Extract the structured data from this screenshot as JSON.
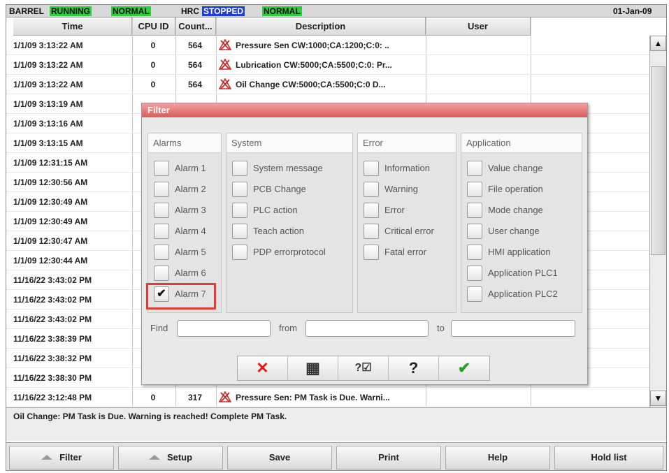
{
  "status": {
    "barrel_label": "BARREL",
    "barrel_state": "RUNNING",
    "barrel_mode": "NORMAL",
    "hrc_label": "HRC",
    "hrc_state": "STOPPED",
    "hrc_mode": "NORMAL",
    "date": "01-Jan-09"
  },
  "table": {
    "headers": {
      "time": "Time",
      "cpu": "CPU ID",
      "count": "Count...",
      "description": "Description",
      "user": "User"
    },
    "rows": [
      {
        "time": "1/1/09 3:13:22 AM",
        "cpu": "0",
        "count": "564",
        "desc": "Pressure Sen CW:1000;CA:1200;C:0: ..",
        "icon": "alarm-icon"
      },
      {
        "time": "1/1/09 3:13:22 AM",
        "cpu": "0",
        "count": "564",
        "desc": "Lubrication CW:5000;CA:5500;C:0: Pr...",
        "icon": "alarm-icon"
      },
      {
        "time": "1/1/09 3:13:22 AM",
        "cpu": "0",
        "count": "564",
        "desc": "Oil Change CW:5000;CA:5500;C:0 D...",
        "icon": "alarm-icon"
      },
      {
        "time": "1/1/09 3:13:19 AM"
      },
      {
        "time": "1/1/09 3:13:16 AM"
      },
      {
        "time": "1/1/09 3:13:15 AM"
      },
      {
        "time": "1/1/09 12:31:15 AM"
      },
      {
        "time": "1/1/09 12:30:56 AM"
      },
      {
        "time": "1/1/09 12:30:49 AM"
      },
      {
        "time": "1/1/09 12:30:49 AM"
      },
      {
        "time": "1/1/09 12:30:47 AM"
      },
      {
        "time": "1/1/09 12:30:44 AM"
      },
      {
        "time": "11/16/22 3:43:02 PM"
      },
      {
        "time": "11/16/22 3:43:02 PM"
      },
      {
        "time": "11/16/22 3:43:02 PM"
      },
      {
        "time": "11/16/22 3:38:39 PM"
      },
      {
        "time": "11/16/22 3:38:32 PM"
      },
      {
        "time": "11/16/22 3:38:30 PM"
      },
      {
        "time": "11/16/22 3:12:48 PM",
        "cpu": "0",
        "count": "317",
        "desc": "Pressure Sen: PM Task is Due. Warni...",
        "icon": "alarm-icon"
      }
    ]
  },
  "message": "Oil Change: PM Task is Due. Warning is reached! Complete PM Task.",
  "buttons": {
    "filter": "Filter",
    "setup": "Setup",
    "save": "Save",
    "print": "Print",
    "help": "Help",
    "hold_list": "Hold list"
  },
  "dialog": {
    "title": "Filter",
    "groups": {
      "alarms": {
        "title": "Alarms",
        "items": [
          {
            "label": "Alarm 1",
            "checked": false
          },
          {
            "label": "Alarm 2",
            "checked": false
          },
          {
            "label": "Alarm 3",
            "checked": false
          },
          {
            "label": "Alarm 4",
            "checked": false
          },
          {
            "label": "Alarm 5",
            "checked": false
          },
          {
            "label": "Alarm 6",
            "checked": false
          },
          {
            "label": "Alarm 7",
            "checked": true
          }
        ]
      },
      "system": {
        "title": "System",
        "items": [
          {
            "label": "System message",
            "checked": false
          },
          {
            "label": "PCB Change",
            "checked": false
          },
          {
            "label": "PLC action",
            "checked": false
          },
          {
            "label": "Teach action",
            "checked": false
          },
          {
            "label": "PDP errorprotocol",
            "checked": false
          }
        ]
      },
      "error": {
        "title": "Error",
        "items": [
          {
            "label": "Information",
            "checked": false
          },
          {
            "label": "Warning",
            "checked": false
          },
          {
            "label": "Error",
            "checked": false
          },
          {
            "label": "Critical error",
            "checked": false
          },
          {
            "label": "Fatal error",
            "checked": false
          }
        ]
      },
      "application": {
        "title": "Application",
        "items": [
          {
            "label": "Value change",
            "checked": false
          },
          {
            "label": "File operation",
            "checked": false
          },
          {
            "label": "Mode change",
            "checked": false
          },
          {
            "label": "User change",
            "checked": false
          },
          {
            "label": "HMI application",
            "checked": false
          },
          {
            "label": "Application PLC1",
            "checked": false
          },
          {
            "label": "Application PLC2",
            "checked": false
          }
        ]
      }
    },
    "find": {
      "find_label": "Find",
      "from_label": "from",
      "to_label": "to",
      "find_value": "",
      "from_value": "",
      "to_value": ""
    },
    "actions": {
      "cancel_glyph": "✕",
      "grid_glyph": "▦",
      "select_glyph": "?☑",
      "help_glyph": "?",
      "ok_glyph": "✔"
    }
  },
  "colors": {
    "running": "#2ecc40",
    "stopped": "#1a3fd6",
    "alarm": "#c62828",
    "dialog_title": "#d95d5d",
    "ok": "#2e9d2e",
    "cancel": "#e01b1b"
  }
}
